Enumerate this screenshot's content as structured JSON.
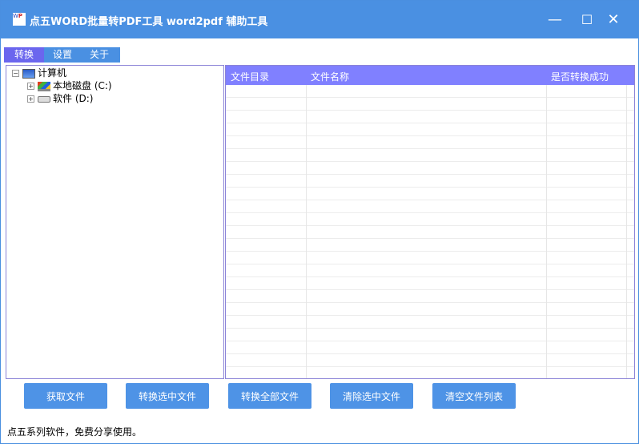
{
  "window": {
    "title": "点五WORD批量转PDF工具 word2pdf 辅助工具",
    "icon_text": "W",
    "icon_sub": "P",
    "minimize": "—",
    "maximize": "☐",
    "close": "✕"
  },
  "tabs": [
    {
      "label": "转换",
      "active": true
    },
    {
      "label": "设置"
    },
    {
      "label": "关于"
    }
  ],
  "tree": {
    "root": "计算机",
    "children": [
      {
        "label": "本地磁盘 (C:)"
      },
      {
        "label": "软件 (D:)"
      }
    ],
    "collapse": "−",
    "expand": "+"
  },
  "grid": {
    "columns": [
      "文件目录",
      "文件名称",
      "是否转换成功"
    ],
    "rows": []
  },
  "buttons": [
    "获取文件",
    "转换选中文件",
    "转换全部文件",
    "清除选中文件",
    "清空文件列表"
  ],
  "status": "点五系列软件，免费分享使用。"
}
